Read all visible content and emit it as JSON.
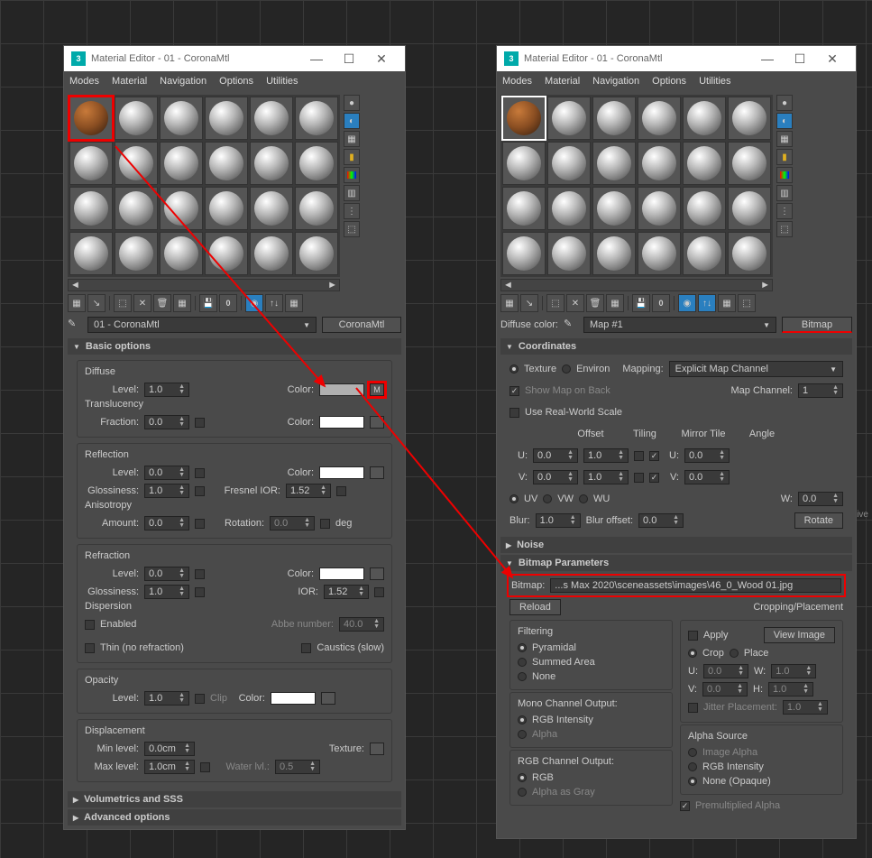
{
  "window": {
    "title": "Material Editor - 01 - CoronaMtl",
    "app_icon": "3",
    "menus": [
      "Modes",
      "Material",
      "Navigation",
      "Options",
      "Utilities"
    ]
  },
  "left": {
    "material_dropdown": "01 - CoronaMtl",
    "type_button": "CoronaMtl",
    "rollouts": {
      "basic": "Basic options",
      "diffuse": "Diffuse",
      "level": "Level:",
      "color": "Color:",
      "translucency": "Translucency",
      "fraction": "Fraction:",
      "reflection": "Reflection",
      "gloss": "Glossiness:",
      "fresnel": "Fresnel IOR:",
      "anisotropy": "Anisotropy",
      "amount": "Amount:",
      "rotation": "Rotation:",
      "deg": "deg",
      "refraction": "Refraction",
      "ior": "IOR:",
      "dispersion": "Dispersion",
      "enabled": "Enabled",
      "abbe": "Abbe number:",
      "thin": "Thin (no refraction)",
      "caustics": "Caustics (slow)",
      "opacity": "Opacity",
      "clip": "Clip",
      "displacement": "Displacement",
      "minlvl": "Min level:",
      "maxlvl": "Max level:",
      "texture": "Texture:",
      "waterlvl": "Water lvl.:",
      "volumetrics": "Volumetrics and SSS",
      "advanced": "Advanced options"
    },
    "vals": {
      "one": "1.0",
      "zero": "0.0",
      "ior": "1.52",
      "abbe": "40.0",
      "cm0": "0.0cm",
      "cm1": "1.0cm",
      "half": "0.5",
      "m": "M"
    }
  },
  "right": {
    "diffuse_color": "Diffuse color:",
    "map_dropdown": "Map #1",
    "bitmap_btn": "Bitmap",
    "coordinates": "Coordinates",
    "texture": "Texture",
    "environ": "Environ",
    "mapping": "Mapping:",
    "mapping_val": "Explicit Map Channel",
    "show_map": "Show Map on Back",
    "map_channel": "Map Channel:",
    "map_channel_val": "1",
    "real_world": "Use Real-World Scale",
    "offset": "Offset",
    "tiling": "Tiling",
    "mirror_tile": "Mirror Tile",
    "angle": "Angle",
    "u": "U:",
    "v": "V:",
    "w": "W:",
    "uv": "UV",
    "vw": "VW",
    "wu": "WU",
    "blur": "Blur:",
    "blur_offset": "Blur offset:",
    "rotate": "Rotate",
    "noise": "Noise",
    "bitmap_params": "Bitmap Parameters",
    "bitmap_lbl": "Bitmap:",
    "bitmap_path": "...s Max 2020\\sceneassets\\images\\46_0_Wood 01.jpg",
    "reload": "Reload",
    "filtering": "Filtering",
    "pyramidal": "Pyramidal",
    "summed": "Summed Area",
    "none": "None",
    "mono": "Mono Channel Output:",
    "rgb_int": "RGB Intensity",
    "alpha": "Alpha",
    "rgb_out": "RGB Channel Output:",
    "rgb": "RGB",
    "alpha_gray": "Alpha as Gray",
    "cropping": "Cropping/Placement",
    "apply": "Apply",
    "view_image": "View Image",
    "crop": "Crop",
    "place": "Place",
    "jitter": "Jitter Placement:",
    "alpha_source": "Alpha Source",
    "img_alpha": "Image Alpha",
    "none_opaque": "None (Opaque)",
    "premult": "Premultiplied Alpha",
    "h": "H:",
    "vals": {
      "zero": "0.0",
      "one": "1.0"
    }
  },
  "viewport": {
    "label": "[Perspective"
  }
}
